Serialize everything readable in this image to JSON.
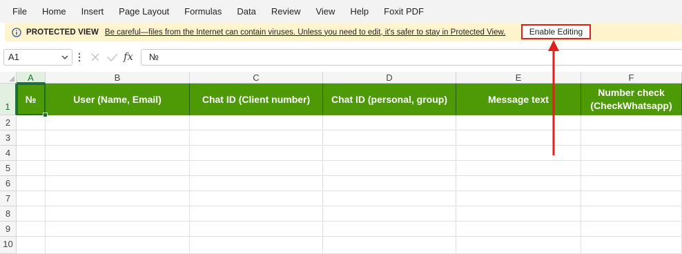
{
  "menu": {
    "items": [
      "File",
      "Home",
      "Insert",
      "Page Layout",
      "Formulas",
      "Data",
      "Review",
      "View",
      "Help",
      "Foxit PDF"
    ]
  },
  "protected_view": {
    "icon": "info-icon",
    "title": "PROTECTED VIEW",
    "message": "Be careful—files from the Internet can contain viruses. Unless you need to edit, it's safer to stay in Protected View.",
    "enable_button": "Enable Editing",
    "highlight_color": "#e02020"
  },
  "formula_bar": {
    "name_box": "A1",
    "formula": "№"
  },
  "sheet": {
    "columns": [
      "A",
      "B",
      "C",
      "D",
      "E",
      "F"
    ],
    "active_column": "A",
    "active_row": "1",
    "rows": [
      "1",
      "2",
      "3",
      "4",
      "5",
      "6",
      "7",
      "8",
      "9",
      "10"
    ],
    "header_row": [
      "№",
      "User (Name, Email)",
      "Chat ID (Client number)",
      "Chat ID (personal, group)",
      "Message text",
      "Number check (CheckWhatsapp)"
    ],
    "header_fill": "#4e9a06",
    "header_text_color": "#ffffff"
  }
}
